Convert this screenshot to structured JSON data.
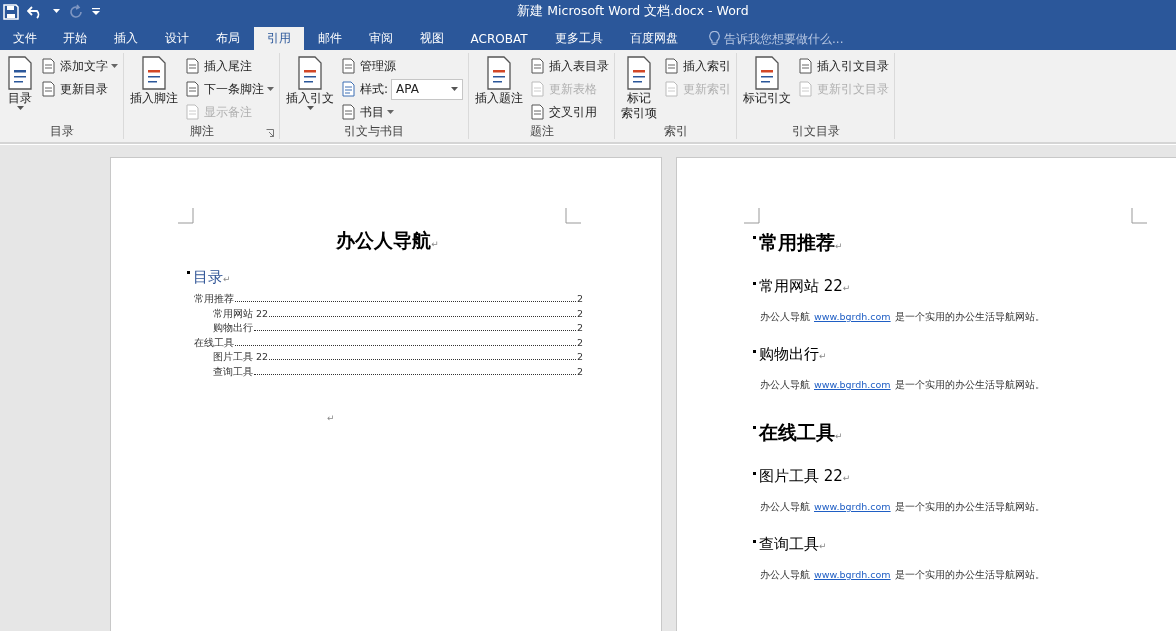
{
  "window": {
    "title": "新建 Microsoft Word 文档.docx - Word"
  },
  "tabs": [
    {
      "label": "文件",
      "selected": false
    },
    {
      "label": "开始",
      "selected": false
    },
    {
      "label": "插入",
      "selected": false
    },
    {
      "label": "设计",
      "selected": false
    },
    {
      "label": "布局",
      "selected": false
    },
    {
      "label": "引用",
      "selected": true
    },
    {
      "label": "邮件",
      "selected": false
    },
    {
      "label": "审阅",
      "selected": false
    },
    {
      "label": "视图",
      "selected": false
    },
    {
      "label": "ACROBAT",
      "selected": false
    },
    {
      "label": "更多工具",
      "selected": false
    },
    {
      "label": "百度网盘",
      "selected": false
    }
  ],
  "tell_me": {
    "placeholder": "告诉我您想要做什么..."
  },
  "ribbon": [
    {
      "label": "目录",
      "launcher": false,
      "large": {
        "lines": [
          "目录"
        ],
        "caret": true
      },
      "small": [
        {
          "kind": "button",
          "label": "添加文字",
          "caret": true,
          "disabled": false
        },
        {
          "kind": "button",
          "label": "更新目录",
          "caret": false,
          "disabled": false
        }
      ]
    },
    {
      "label": "脚注",
      "launcher": true,
      "large": {
        "lines": [
          "插入脚注"
        ],
        "caret": false
      },
      "small": [
        {
          "kind": "button",
          "label": "插入尾注",
          "caret": false,
          "disabled": false
        },
        {
          "kind": "button",
          "label": "下一条脚注",
          "caret": true,
          "disabled": false
        },
        {
          "kind": "button",
          "label": "显示备注",
          "caret": false,
          "disabled": true
        }
      ]
    },
    {
      "label": "引文与书目",
      "launcher": false,
      "large": {
        "lines": [
          "插入引文"
        ],
        "caret": true
      },
      "small": [
        {
          "kind": "button",
          "label": "管理源",
          "caret": false,
          "disabled": false
        },
        {
          "kind": "combo",
          "label": "样式:",
          "value": "APA",
          "caret": true
        },
        {
          "kind": "button",
          "label": "书目",
          "caret": true,
          "disabled": false
        }
      ]
    },
    {
      "label": "题注",
      "launcher": false,
      "large": {
        "lines": [
          "插入题注"
        ],
        "caret": false
      },
      "small": [
        {
          "kind": "button",
          "label": "插入表目录",
          "caret": false,
          "disabled": false
        },
        {
          "kind": "button",
          "label": "更新表格",
          "caret": false,
          "disabled": true
        },
        {
          "kind": "button",
          "label": "交叉引用",
          "caret": false,
          "disabled": false
        }
      ]
    },
    {
      "label": "索引",
      "launcher": false,
      "large": {
        "lines": [
          "标记",
          "索引项"
        ],
        "caret": false
      },
      "small": [
        {
          "kind": "button",
          "label": "插入索引",
          "caret": false,
          "disabled": false
        },
        {
          "kind": "button",
          "label": "更新索引",
          "caret": false,
          "disabled": true
        }
      ]
    },
    {
      "label": "引文目录",
      "launcher": false,
      "large": {
        "lines": [
          "标记引文"
        ],
        "caret": false
      },
      "small": [
        {
          "kind": "button",
          "label": "插入引文目录",
          "caret": false,
          "disabled": false
        },
        {
          "kind": "button",
          "label": "更新引文目录",
          "caret": false,
          "disabled": true
        }
      ]
    }
  ],
  "page_1": {
    "title": "办公人导航",
    "title_mark": "↵",
    "toc_heading": "目录",
    "toc_heading_mark": "↵",
    "toc": [
      {
        "text": "常用推荐",
        "page": "2",
        "children": [
          {
            "text": "常用网站 22",
            "page": "2"
          },
          {
            "text": "购物出行",
            "page": "2"
          }
        ]
      },
      {
        "text": "在线工具",
        "page": "2",
        "children": [
          {
            "text": "图片工具 22",
            "page": "2"
          },
          {
            "text": "查询工具",
            "page": "2"
          }
        ]
      }
    ],
    "end_mark": "↵"
  },
  "page_2": {
    "blocks": [
      {
        "kind": "heading1",
        "text": "常用推荐",
        "mark": "↵"
      },
      {
        "kind": "heading2",
        "text": "常用网站 22",
        "mark": "↵"
      },
      {
        "kind": "paragraph",
        "before": "办公人导航",
        "link": "www.bgrdh.com",
        "after": "是一个实用的办公生活导航网站。"
      },
      {
        "kind": "heading2",
        "text": "购物出行",
        "mark": "↵"
      },
      {
        "kind": "paragraph",
        "before": "办公人导航",
        "link": "www.bgrdh.com",
        "after": "是一个实用的办公生活导航网站。"
      },
      {
        "kind": "heading1",
        "text": "在线工具",
        "mark": "↵"
      },
      {
        "kind": "heading2",
        "text": "图片工具 22",
        "mark": "↵"
      },
      {
        "kind": "paragraph",
        "before": "办公人导航",
        "link": "www.bgrdh.com",
        "after": "是一个实用的办公生活导航网站。"
      },
      {
        "kind": "heading2",
        "text": "查询工具",
        "mark": "↵"
      },
      {
        "kind": "paragraph",
        "before": "办公人导航",
        "link": "www.bgrdh.com",
        "after": "是一个实用的办公生活导航网站。"
      }
    ]
  }
}
